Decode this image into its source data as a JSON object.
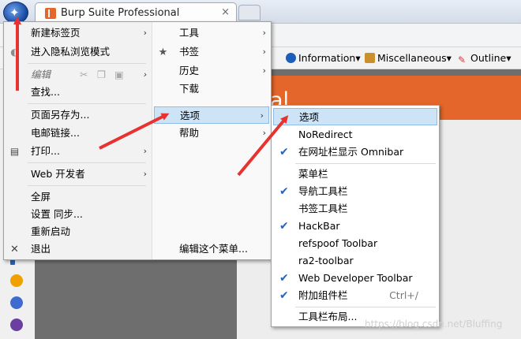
{
  "tab": {
    "title": "Burp Suite Professional",
    "close_glyph": "×"
  },
  "toolbar": {
    "items": [
      "Information▾",
      "Miscellaneous▾",
      "Outline▾"
    ]
  },
  "page": {
    "banner_text": "al"
  },
  "main_menu": {
    "left": [
      {
        "label": "新建标签页",
        "arrow": "›"
      },
      {
        "label": "进入隐私浏览模式"
      },
      {
        "label": "编辑",
        "arrow": "›",
        "disabled": true
      },
      {
        "label": "查找..."
      },
      {
        "label": "页面另存为..."
      },
      {
        "label": "电邮链接..."
      },
      {
        "label": "打印...",
        "arrow": "›"
      },
      {
        "label": "Web 开发者",
        "arrow": "›"
      },
      {
        "label": "全屏"
      },
      {
        "label": "设置 同步..."
      },
      {
        "label": "重新启动"
      },
      {
        "label": "退出"
      }
    ],
    "right": [
      {
        "label": "工具",
        "arrow": "›"
      },
      {
        "label": "书签",
        "arrow": "›"
      },
      {
        "label": "历史",
        "arrow": "›"
      },
      {
        "label": "下载"
      },
      {
        "label": "选项",
        "arrow": "›"
      },
      {
        "label": "帮助",
        "arrow": "›"
      },
      {
        "label": "编辑这个菜单..."
      }
    ]
  },
  "sub_menu": {
    "items": [
      {
        "label": "选项",
        "checked": false
      },
      {
        "label": "NoRedirect",
        "checked": false
      },
      {
        "label": "在网址栏显示 Omnibar",
        "checked": true
      },
      {
        "label": "菜单栏",
        "checked": false
      },
      {
        "label": "导航工具栏",
        "checked": true
      },
      {
        "label": "书签工具栏",
        "checked": false
      },
      {
        "label": "HackBar",
        "checked": true
      },
      {
        "label": "refspoof Toolbar",
        "checked": false
      },
      {
        "label": "ra2-toolbar",
        "checked": false
      },
      {
        "label": "Web Developer Toolbar",
        "checked": true
      },
      {
        "label": "附加组件栏",
        "checked": true,
        "shortcut": "Ctrl+/"
      },
      {
        "label": "工具栏布局...",
        "checked": false
      }
    ]
  },
  "watermark": "https://blog.csdn.net/Bluffing",
  "colors": {
    "accent_orange": "#e4662a",
    "highlight": "#cde4f7",
    "arrow_red": "#e8322f",
    "check_blue": "#2a62b4"
  }
}
